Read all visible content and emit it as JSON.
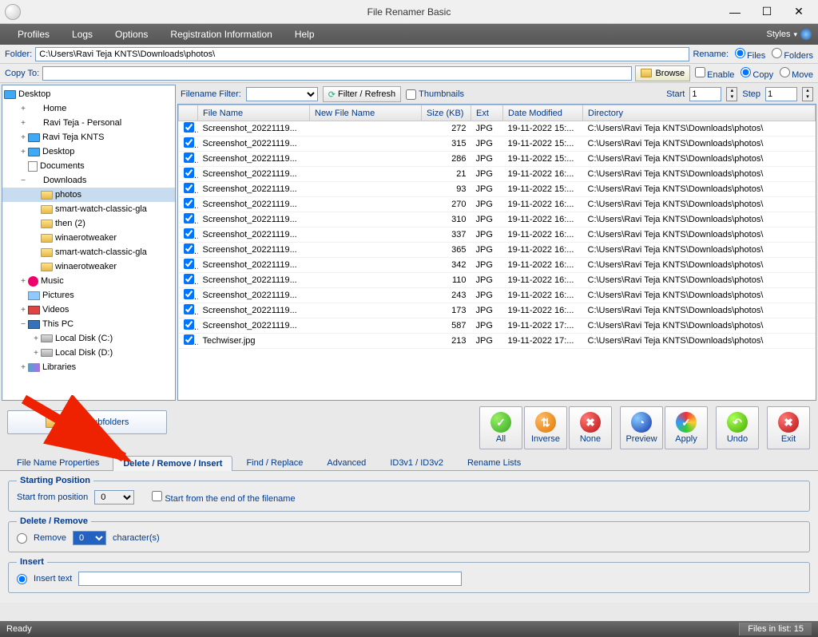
{
  "app": {
    "title": "File Renamer Basic"
  },
  "menu": {
    "profiles": "Profiles",
    "logs": "Logs",
    "options": "Options",
    "registration": "Registration Information",
    "help": "Help",
    "styles": "Styles"
  },
  "path": {
    "folder_label": "Folder:",
    "folder_value": "C:\\Users\\Ravi Teja KNTS\\Downloads\\photos\\",
    "copyto_label": "Copy To:",
    "copyto_value": "",
    "browse": "Browse",
    "rename_label": "Rename:",
    "files": "Files",
    "folders": "Folders",
    "enable": "Enable",
    "copy": "Copy",
    "move": "Move"
  },
  "filter": {
    "label": "Filename Filter:",
    "button": "Filter / Refresh",
    "thumbnails": "Thumbnails",
    "start_label": "Start",
    "start_value": "1",
    "step_label": "Step",
    "step_value": "1"
  },
  "tree": {
    "root": "Desktop",
    "items": [
      {
        "exp": "+",
        "ico": "home",
        "label": "Home",
        "depth": 1
      },
      {
        "exp": "+",
        "ico": "cloud",
        "label": "Ravi Teja - Personal",
        "depth": 1
      },
      {
        "exp": "+",
        "ico": "user",
        "label": "Ravi Teja KNTS",
        "depth": 1
      },
      {
        "exp": "+",
        "ico": "desktop",
        "label": "Desktop",
        "depth": 1
      },
      {
        "exp": "",
        "ico": "doc",
        "label": "Documents",
        "depth": 1
      },
      {
        "exp": "−",
        "ico": "dl",
        "label": "Downloads",
        "depth": 1
      },
      {
        "exp": "",
        "ico": "folder",
        "label": "photos",
        "depth": 2,
        "selected": true
      },
      {
        "exp": "",
        "ico": "folder",
        "label": "smart-watch-classic-gla",
        "depth": 2
      },
      {
        "exp": "",
        "ico": "folder",
        "label": "then (2)",
        "depth": 2
      },
      {
        "exp": "",
        "ico": "folder",
        "label": "winaerotweaker",
        "depth": 2
      },
      {
        "exp": "",
        "ico": "folder",
        "label": "smart-watch-classic-gla",
        "depth": 2
      },
      {
        "exp": "",
        "ico": "folder",
        "label": "winaerotweaker",
        "depth": 2
      },
      {
        "exp": "+",
        "ico": "music",
        "label": "Music",
        "depth": 1
      },
      {
        "exp": "",
        "ico": "pic",
        "label": "Pictures",
        "depth": 1
      },
      {
        "exp": "+",
        "ico": "vid",
        "label": "Videos",
        "depth": 1
      },
      {
        "exp": "−",
        "ico": "pc",
        "label": "This PC",
        "depth": 1
      },
      {
        "exp": "+",
        "ico": "disk",
        "label": "Local Disk (C:)",
        "depth": 2
      },
      {
        "exp": "+",
        "ico": "disk",
        "label": "Local Disk (D:)",
        "depth": 2
      },
      {
        "exp": "+",
        "ico": "lib",
        "label": "Libraries",
        "depth": 1
      }
    ]
  },
  "grid": {
    "columns": [
      "",
      "File Name",
      "New File Name",
      "Size (KB)",
      "Ext",
      "Date Modified",
      "Directory"
    ],
    "rows": [
      {
        "name": "Screenshot_20221119...",
        "size": "272",
        "ext": "JPG",
        "date": "19-11-2022 15:...",
        "dir": "C:\\Users\\Ravi Teja KNTS\\Downloads\\photos\\"
      },
      {
        "name": "Screenshot_20221119...",
        "size": "315",
        "ext": "JPG",
        "date": "19-11-2022 15:...",
        "dir": "C:\\Users\\Ravi Teja KNTS\\Downloads\\photos\\"
      },
      {
        "name": "Screenshot_20221119...",
        "size": "286",
        "ext": "JPG",
        "date": "19-11-2022 15:...",
        "dir": "C:\\Users\\Ravi Teja KNTS\\Downloads\\photos\\"
      },
      {
        "name": "Screenshot_20221119...",
        "size": "21",
        "ext": "JPG",
        "date": "19-11-2022 16:...",
        "dir": "C:\\Users\\Ravi Teja KNTS\\Downloads\\photos\\"
      },
      {
        "name": "Screenshot_20221119...",
        "size": "93",
        "ext": "JPG",
        "date": "19-11-2022 15:...",
        "dir": "C:\\Users\\Ravi Teja KNTS\\Downloads\\photos\\"
      },
      {
        "name": "Screenshot_20221119...",
        "size": "270",
        "ext": "JPG",
        "date": "19-11-2022 16:...",
        "dir": "C:\\Users\\Ravi Teja KNTS\\Downloads\\photos\\"
      },
      {
        "name": "Screenshot_20221119...",
        "size": "310",
        "ext": "JPG",
        "date": "19-11-2022 16:...",
        "dir": "C:\\Users\\Ravi Teja KNTS\\Downloads\\photos\\"
      },
      {
        "name": "Screenshot_20221119...",
        "size": "337",
        "ext": "JPG",
        "date": "19-11-2022 16:...",
        "dir": "C:\\Users\\Ravi Teja KNTS\\Downloads\\photos\\"
      },
      {
        "name": "Screenshot_20221119...",
        "size": "365",
        "ext": "JPG",
        "date": "19-11-2022 16:...",
        "dir": "C:\\Users\\Ravi Teja KNTS\\Downloads\\photos\\"
      },
      {
        "name": "Screenshot_20221119...",
        "size": "342",
        "ext": "JPG",
        "date": "19-11-2022 16:...",
        "dir": "C:\\Users\\Ravi Teja KNTS\\Downloads\\photos\\"
      },
      {
        "name": "Screenshot_20221119...",
        "size": "110",
        "ext": "JPG",
        "date": "19-11-2022 16:...",
        "dir": "C:\\Users\\Ravi Teja KNTS\\Downloads\\photos\\"
      },
      {
        "name": "Screenshot_20221119...",
        "size": "243",
        "ext": "JPG",
        "date": "19-11-2022 16:...",
        "dir": "C:\\Users\\Ravi Teja KNTS\\Downloads\\photos\\"
      },
      {
        "name": "Screenshot_20221119...",
        "size": "173",
        "ext": "JPG",
        "date": "19-11-2022 16:...",
        "dir": "C:\\Users\\Ravi Teja KNTS\\Downloads\\photos\\"
      },
      {
        "name": "Screenshot_20221119...",
        "size": "587",
        "ext": "JPG",
        "date": "19-11-2022 17:...",
        "dir": "C:\\Users\\Ravi Teja KNTS\\Downloads\\photos\\"
      },
      {
        "name": "Techwiser.jpg",
        "size": "213",
        "ext": "JPG",
        "date": "19-11-2022 17:...",
        "dir": "C:\\Users\\Ravi Teja KNTS\\Downloads\\photos\\"
      }
    ]
  },
  "scan": "Scan Subfolders",
  "actions": {
    "all": "All",
    "inverse": "Inverse",
    "none": "None",
    "preview": "Preview",
    "apply": "Apply",
    "undo": "Undo",
    "exit": "Exit"
  },
  "tabs": {
    "t1": "File Name Properties",
    "t2": "Delete / Remove / Insert",
    "t3": "Find / Replace",
    "t4": "Advanced",
    "t5": "ID3v1 / ID3v2",
    "t6": "Rename Lists"
  },
  "panel": {
    "starting_legend": "Starting Position",
    "start_from": "Start from position",
    "start_val": "0",
    "start_end": "Start from the end of the filename",
    "delete_legend": "Delete / Remove",
    "remove": "Remove",
    "remove_val": "0",
    "chars": "character(s)",
    "insert_legend": "Insert",
    "insert_text": "Insert text"
  },
  "status": {
    "ready": "Ready",
    "files": "Files in list: 15"
  }
}
